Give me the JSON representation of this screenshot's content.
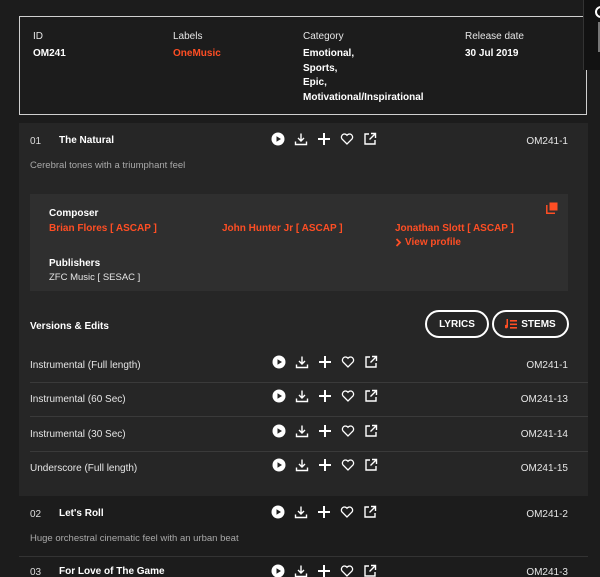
{
  "info": {
    "id_label": "ID",
    "id_value": "OM241",
    "labels_label": "Labels",
    "labels_value": "OneMusic",
    "category_label": "Category",
    "category_values": [
      "Emotional,",
      "Sports,",
      "Epic,",
      "Motivational/Inspirational"
    ],
    "release_label": "Release date",
    "release_value": "30 Jul 2019"
  },
  "tracks": [
    {
      "num": "01",
      "title": "The Natural",
      "code": "OM241-1",
      "desc": "Cerebral tones with a triumphant feel"
    },
    {
      "num": "02",
      "title": "Let's Roll",
      "code": "OM241-2",
      "desc": "Huge orchestral cinematic feel with an urban beat"
    },
    {
      "num": "03",
      "title": "For Love of The Game",
      "code": "OM241-3"
    }
  ],
  "credits": {
    "composer_label": "Composer",
    "composers": [
      "Brian Flores [ ASCAP ]",
      "John Hunter Jr [ ASCAP ]",
      "Jonathan Slott [ ASCAP ]"
    ],
    "view_profile": "View profile",
    "publishers_label": "Publishers",
    "publisher": "ZFC Music [ SESAC ]"
  },
  "versions": {
    "title": "Versions & Edits",
    "lyrics_label": "LYRICS",
    "stems_label": "STEMS",
    "items": [
      {
        "name": "Instrumental (Full length)",
        "code": "OM241-1"
      },
      {
        "name": "Instrumental (60 Sec)",
        "code": "OM241-13"
      },
      {
        "name": "Instrumental (30 Sec)",
        "code": "OM241-14"
      },
      {
        "name": "Underscore (Full length)",
        "code": "OM241-15"
      }
    ]
  },
  "colors": {
    "accent": "#ff4e24",
    "background": "#1c1c1c",
    "panel": "#262626",
    "credits_panel": "#2f2f2f"
  },
  "icons": [
    "play-icon",
    "download-icon",
    "plus-icon",
    "heart-icon",
    "share-icon",
    "copy-icon",
    "stems-icon",
    "chevron-right-icon"
  ]
}
